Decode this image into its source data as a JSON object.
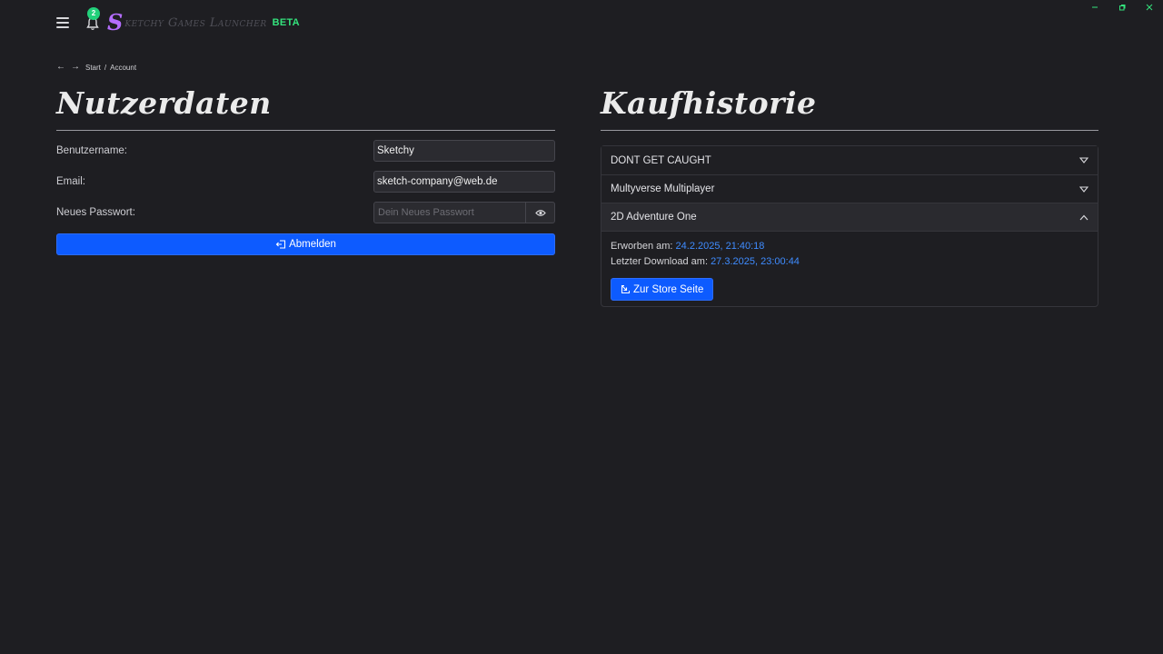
{
  "app": {
    "brand_initial": "S",
    "brand_name": "ketchy Games Launcher",
    "beta_label": "BETA",
    "notification_count": "2"
  },
  "breadcrumb": {
    "back_icon": "arrow-left-icon",
    "forward_icon": "arrow-right-icon",
    "items": [
      "Start",
      "Account"
    ],
    "separator": "/"
  },
  "user_data": {
    "heading": "Nutzerdaten",
    "username_label": "Benutzername:",
    "username_value": "Sketchy",
    "email_label": "Email:",
    "email_value": "sketch-company@web.de",
    "password_label": "Neues Passwort:",
    "password_placeholder": "Dein Neues Passwort",
    "logout_label": "Abmelden"
  },
  "purchase_history": {
    "heading": "Kaufhistorie",
    "items": [
      {
        "title": "DONT GET CAUGHT",
        "expanded": false
      },
      {
        "title": "Multyverse Multiplayer",
        "expanded": false
      },
      {
        "title": "2D Adventure One",
        "expanded": true,
        "acquired_label": "Erworben am:",
        "acquired_value": "24.2.2025, 21:40:18",
        "download_label": "Letzter Download am:",
        "download_value": "27.3.2025, 23:00:44",
        "store_button": "Zur Store Seite"
      }
    ]
  },
  "colors": {
    "background": "#1e1e22",
    "primary_button": "#0d5bff",
    "link_value": "#3f8cff",
    "beta": "#34e27c",
    "brand_accent": "#b46dff",
    "badge": "#22d07a"
  }
}
